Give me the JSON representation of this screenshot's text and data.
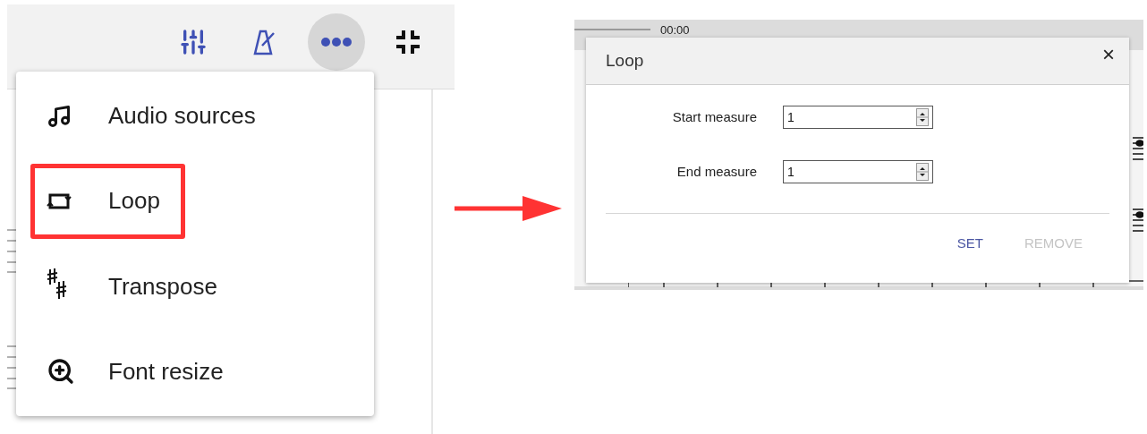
{
  "toolbar": {
    "buttons": [
      {
        "kind": "mixer",
        "selected": false
      },
      {
        "kind": "metronome",
        "selected": false
      },
      {
        "kind": "more",
        "selected": true
      },
      {
        "kind": "exit_fullscreen",
        "selected": false
      }
    ]
  },
  "menu": {
    "items": [
      {
        "kind": "music",
        "label": "Audio sources",
        "highlighted": false
      },
      {
        "kind": "loop",
        "label": "Loop",
        "highlighted": true
      },
      {
        "kind": "transpose",
        "label": "Transpose",
        "highlighted": false
      },
      {
        "kind": "zoom",
        "label": "Font resize",
        "highlighted": false
      }
    ]
  },
  "player": {
    "time": "00:00"
  },
  "dialog": {
    "title": "Loop",
    "close": "×",
    "fields": [
      {
        "label": "Start measure",
        "value": "1"
      },
      {
        "label": "End measure",
        "value": "1"
      }
    ],
    "buttons": [
      {
        "label": "SET",
        "disabled": false
      },
      {
        "label": "REMOVE",
        "disabled": true
      }
    ]
  }
}
